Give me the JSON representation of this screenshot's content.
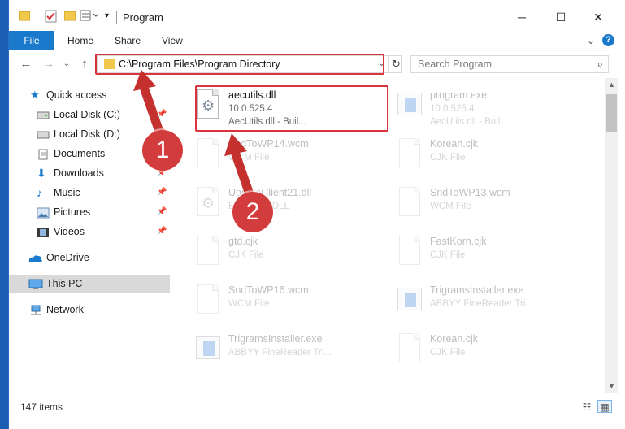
{
  "window": {
    "title": "Program"
  },
  "ribbon": {
    "tabs": [
      "File",
      "Home",
      "Share",
      "View"
    ],
    "help": "?"
  },
  "address": {
    "path": "C:\\Program Files\\Program Directory",
    "search_placeholder": "Search Program"
  },
  "sidebar": {
    "items": [
      {
        "label": "Quick access",
        "icon": "star-icon",
        "pinned": false
      },
      {
        "label": "Local Disk (C:)",
        "icon": "drive-icon",
        "pinned": true
      },
      {
        "label": "Local Disk (D:)",
        "icon": "drive-icon",
        "pinned": true
      },
      {
        "label": "Documents",
        "icon": "documents-icon",
        "pinned": true
      },
      {
        "label": "Downloads",
        "icon": "download-icon",
        "pinned": true
      },
      {
        "label": "Music",
        "icon": "music-icon",
        "pinned": true
      },
      {
        "label": "Pictures",
        "icon": "pictures-icon",
        "pinned": true
      },
      {
        "label": "Videos",
        "icon": "videos-icon",
        "pinned": true
      },
      {
        "label": "OneDrive",
        "icon": "cloud-icon",
        "pinned": false
      },
      {
        "label": "This PC",
        "icon": "computer-icon",
        "pinned": false,
        "selected": true
      },
      {
        "label": "Network",
        "icon": "network-icon",
        "pinned": false
      }
    ]
  },
  "files": [
    {
      "name": "aecutils.dll",
      "line1": "10.0.525.4",
      "line2": "AecUtils.dll - Buil...",
      "icon": "dll",
      "highlighted": true
    },
    {
      "name": "program.exe",
      "line1": "10.0.525.4",
      "line2": "AecUtils.dll - Buil...",
      "icon": "app",
      "highlighted": false
    },
    {
      "name": "SndToWP14.wcm",
      "line1": "WCM File",
      "line2": "",
      "icon": "doc",
      "highlighted": false
    },
    {
      "name": "Korean.cjk",
      "line1": "CJK File",
      "line2": "",
      "icon": "doc",
      "highlighted": false
    },
    {
      "name": "UpdateClient21.dll",
      "line1": "Extension DLL",
      "line2": "",
      "icon": "dll",
      "highlighted": false
    },
    {
      "name": "SndToWP13.wcm",
      "line1": "WCM File",
      "line2": "",
      "icon": "doc",
      "highlighted": false
    },
    {
      "name": "gtd.cjk",
      "line1": "CJK File",
      "line2": "",
      "icon": "doc",
      "highlighted": false
    },
    {
      "name": "FastKorn.cjk",
      "line1": "CJK File",
      "line2": "",
      "icon": "doc",
      "highlighted": false
    },
    {
      "name": "SndToWP16.wcm",
      "line1": "WCM File",
      "line2": "",
      "icon": "doc",
      "highlighted": false
    },
    {
      "name": "TrigramsInstaller.exe",
      "line1": "ABBYY FineReader Tri...",
      "line2": "",
      "icon": "app",
      "highlighted": false
    },
    {
      "name": "TrigramsInstaller.exe",
      "line1": "ABBYY FineReader Tri...",
      "line2": "",
      "icon": "app",
      "highlighted": false
    },
    {
      "name": "Korean.cjk",
      "line1": "CJK File",
      "line2": "",
      "icon": "doc",
      "highlighted": false
    }
  ],
  "status": {
    "count": "147 items"
  },
  "annotations": {
    "step1": "1",
    "step2": "2"
  },
  "colors": {
    "accent": "#1979ca",
    "highlight": "#d9343c",
    "badge": "#d33c3c"
  }
}
